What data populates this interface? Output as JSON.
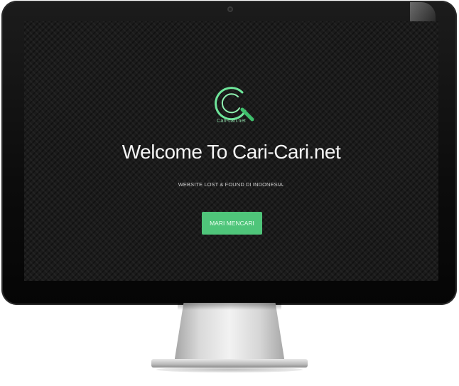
{
  "site": {
    "logo_caption": "Cari-cari.net",
    "headline": "Welcome To Cari-Cari.net",
    "tagline": "WEBSITE LOST & FOUND DI INDONESIA.",
    "cta_label": "MARI MENCARI"
  },
  "icons": {
    "logo": "magnifying-glass-logo-icon"
  },
  "colors": {
    "accent": "#4fc57a",
    "logo_ring": "#6ee59a",
    "screen_bg": "#1b1b1b"
  }
}
